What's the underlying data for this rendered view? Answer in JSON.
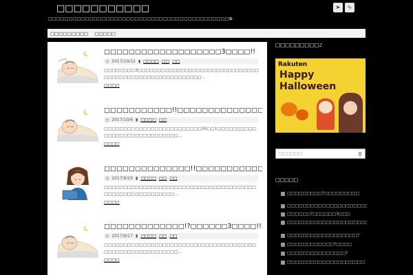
{
  "header": {
    "site_title": "□□□□□□□□□□□",
    "site_desc": "□□□□□□□□□□□□□□□□□□□□□□□□□□□□□□□□□□□□□□□□□□□□✿",
    "icons": [
      "feedly-icon",
      "rss-icon"
    ]
  },
  "nav": {
    "items": [
      "□□□□□□□□□",
      "□□□□□"
    ]
  },
  "entries": [
    {
      "title": "□□□□□□□□□□□□□□□□□□□3□□□□!!",
      "date": "2017/10/12",
      "cats": [
        "□□□□",
        "□□",
        "□□"
      ],
      "body": "□□□□□□□□3□□□□□□□□□□□□□□□□□□□□□□□□□□□□□□□□□□□□□□□□□□□□□□□□□□□□□□□□…",
      "more": "□□□□"
    },
    {
      "title": "□□□□□□□□□□□!!□□□□□□□□□□□□□□□□!?",
      "date": "2017/10/6",
      "cats": [
        "□□□□",
        "□□"
      ],
      "body": "□□□□□□□□□□□□□□□□□□□□□□□□□30□□1□□□□□□□□□□□□□□□□□□□□□□□□□□□□□…",
      "more": "□□□□"
    },
    {
      "title": "□□□□□□□□□□□□□□!!□□□□□□□□□□□□□□!!",
      "date": "2017/9/29",
      "cats": [
        "□□□□",
        "□□",
        "□□"
      ],
      "body": "□□□□□□□□□□□□□□□□□□□□□□□□□□□□□□□□□□□□□□□□□□□□□□□□□□□□□□□□□…",
      "more": "□□□□"
    },
    {
      "title": "□□□□□□□□□□□□□!?□□□□□□3□□□□!!",
      "date": "2017/9/17",
      "cats": [
        "□□□□",
        "□□",
        "□□"
      ],
      "body": "□□□□□□□□□□□□□□□□□□□□□□□□□□□□□□□□□□□□□□□□□□□□□□□□□□□□□□□□□□…",
      "more": "□□□□"
    }
  ],
  "sidebar": {
    "widget1_title": "□□□□□□□□□♪",
    "banner": {
      "brand": "Rakuten",
      "line1": "Happy",
      "line2": "Halloween"
    },
    "search_placeholder": "□□□□□□",
    "widget2_title": "□□□□□",
    "ranking": [
      "□□□□□□□□□?□□□□□□□□□",
      "□□□□□□□□□□□□□□□□□□□□□",
      "□□□□□□?□□□□□□3□□□",
      "□□□□□□□□□□□□□□□□□□□□□",
      "□□□□□□□□□□□□□□□□□□?",
      "□□□□□□□□□□□□?□□□□",
      "□□□□□□□□□□□□□□□?",
      "□□□□□□□□□□□□□□□□□□□□"
    ]
  },
  "colors": {
    "page_bg": "#000000",
    "content_bg": "#ffffff",
    "banner_bg": "#f3d232"
  }
}
